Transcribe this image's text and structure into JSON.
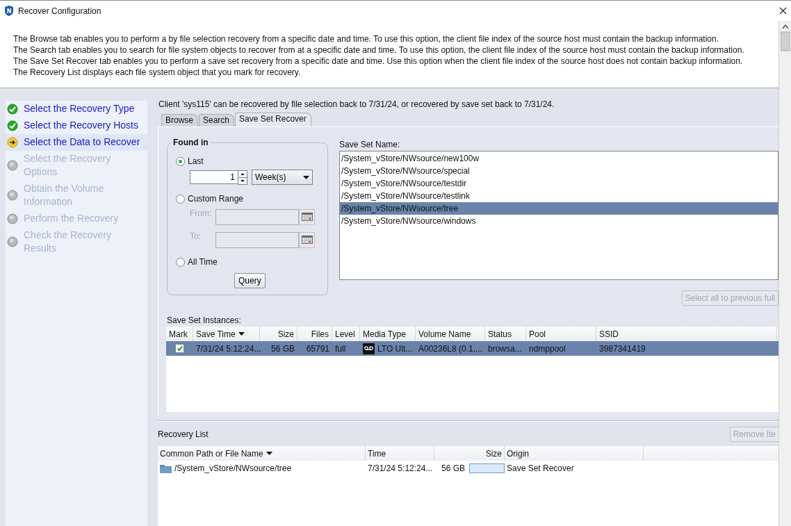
{
  "window": {
    "title": "Recover Configuration"
  },
  "description": [
    "The Browse tab enables you to perform a by file selection recovery from a specific date and time. To use this option, the client file index of the source host must contain the backup information.",
    "The Search tab enables you to search for file system objects to recover from at a specific date and time. To use this option, the client file index of the source host must contain the backup information.",
    "The Save Set Recover tab enables you to perform a save set recovery from a specific date and time.  Use this option when the client file index of the source host does not contain backup information.",
    "The Recovery List displays each file system object that you mark for recovery."
  ],
  "steps": [
    {
      "label": "Select the Recovery Type",
      "kind": "done",
      "selected": false
    },
    {
      "label": "Select the Recovery Hosts",
      "kind": "done",
      "selected": false
    },
    {
      "label": "Select the Data to Recover",
      "kind": "current",
      "selected": true
    },
    {
      "label": "Select the Recovery Options",
      "kind": "pending",
      "selected": false
    },
    {
      "label": "Obtain the Volume Information",
      "kind": "pending",
      "selected": false
    },
    {
      "label": "Perform the Recovery",
      "kind": "pending",
      "selected": false
    },
    {
      "label": "Check the Recovery Results",
      "kind": "pending",
      "selected": false
    }
  ],
  "client_message": "Client 'sys115' can be recovered by file selection back to 7/31/24, or recovered by save set back to 7/31/24.",
  "tabs": [
    {
      "label": "Browse",
      "selected": false
    },
    {
      "label": "Search",
      "selected": false
    },
    {
      "label": "Save Set Recover",
      "selected": true
    }
  ],
  "found_in": {
    "title": "Found in",
    "options": [
      {
        "label": "Last",
        "selected": true
      },
      {
        "label": "Custom Range",
        "selected": false
      },
      {
        "label": "All Time",
        "selected": false
      }
    ],
    "last_value": "1",
    "unit": "Week(s)",
    "from_label": "From:",
    "to_label": "To:",
    "query_button": "Query"
  },
  "save_set_names": {
    "label": "Save Set Name:",
    "items": [
      {
        "name": "/System_vStore/NWsource/new100w",
        "selected": false
      },
      {
        "name": "/System_vStore/NWsource/special",
        "selected": false
      },
      {
        "name": "/System_vStore/NWsource/testdir",
        "selected": false
      },
      {
        "name": "/System_vStore/NWsource/testlink",
        "selected": false
      },
      {
        "name": "/System_vStore/NWsource/tree",
        "selected": true
      },
      {
        "name": "/System_vStore/NWsource/windows",
        "selected": false
      }
    ]
  },
  "select_all_button": {
    "label": "Select all to previous full",
    "disabled": true
  },
  "instances": {
    "label": "Save Set Instances:",
    "columns": [
      {
        "label": "Mark",
        "sorted": false
      },
      {
        "label": "Save Time",
        "sorted": true
      },
      {
        "label": "Size",
        "sorted": false
      },
      {
        "label": "Files",
        "sorted": false
      },
      {
        "label": "Level",
        "sorted": false
      },
      {
        "label": "Media Type",
        "sorted": false
      },
      {
        "label": "Volume Name",
        "sorted": false
      },
      {
        "label": "Status",
        "sorted": false
      },
      {
        "label": "Pool",
        "sorted": false
      },
      {
        "label": "SSID",
        "sorted": false
      }
    ],
    "rows": [
      {
        "checked": true,
        "selected": true,
        "cells": [
          "",
          "7/31/24 5:12:24...",
          "56 GB",
          "65791",
          "full",
          "LTO Ult...",
          "A00236L8 (0.1,...",
          "browsa...",
          "ndmppool",
          "3987341419"
        ]
      }
    ]
  },
  "recovery_list": {
    "title": "Recovery List",
    "remove_button": {
      "label": "Remove Ite",
      "disabled": true
    },
    "columns": [
      {
        "label": "Common Path or File Name",
        "sorted": true
      },
      {
        "label": "Time",
        "sorted": false
      },
      {
        "label": "Size",
        "sorted": false
      },
      {
        "label": "Origin",
        "sorted": false
      }
    ],
    "rows": [
      {
        "cells": [
          "/System_vStore/NWsource/tree",
          "7/31/24 5:12:24...",
          "56 GB",
          "Save Set Recover"
        ]
      }
    ]
  }
}
